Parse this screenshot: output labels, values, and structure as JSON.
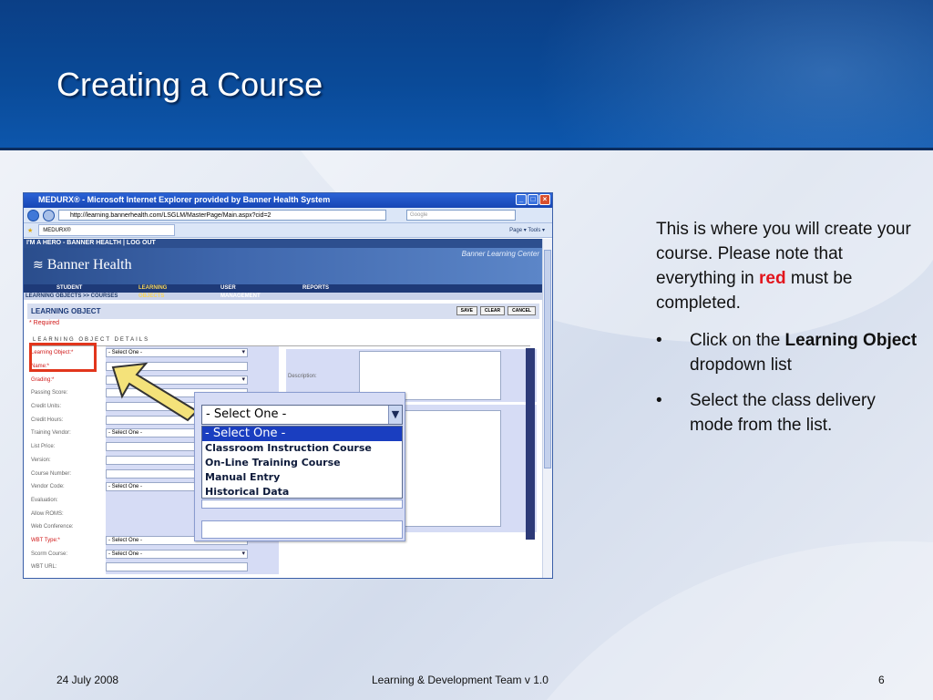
{
  "slide": {
    "title": "Creating a Course",
    "footer_date": "24 July 2008",
    "footer_center": "Learning & Development Team v 1.0",
    "page_number": "6"
  },
  "browser": {
    "window_title": "MEDURX® - Microsoft Internet Explorer provided by Banner Health System",
    "url": "http://learning.bannerhealth.com/LSGLM/MasterPage/Main.aspx?cid=2",
    "search_placeholder": "Google",
    "tab_label": "MEDURX®",
    "tools": "Page ▾  Tools ▾"
  },
  "app": {
    "hero_bar": "I'M A HERO - BANNER HEALTH | LOG OUT",
    "brand": "Banner Health",
    "center_name": "Banner Learning Center",
    "nav": [
      "STUDENT",
      "LEARNING OBJECTS",
      "USER MANAGEMENT",
      "REPORTS"
    ],
    "breadcrumb": "LEARNING OBJECTS >> COURSES",
    "section_title": "LEARNING OBJECT",
    "buttons": {
      "save": "SAVE",
      "clear": "CLEAR",
      "cancel": "CANCEL"
    },
    "required_note": "* Required",
    "details_header": "LEARNING OBJECT DETAILS",
    "description_label": "Description:"
  },
  "form_rows": [
    {
      "label": "Learning Object:*",
      "required": true,
      "value": "- Select One -",
      "select": true
    },
    {
      "label": "Name:*",
      "required": true,
      "value": "",
      "select": false
    },
    {
      "label": "Grading:*",
      "required": true,
      "value": "",
      "select": true
    },
    {
      "label": "Passing Score:",
      "required": false,
      "value": "",
      "select": false
    },
    {
      "label": "Credit Units:",
      "required": false,
      "value": "",
      "select": false
    },
    {
      "label": "Credit Hours:",
      "required": false,
      "value": "",
      "select": false
    },
    {
      "label": "Training Vendor:",
      "required": false,
      "value": "- Select One -",
      "select": true
    },
    {
      "label": "List Price:",
      "required": false,
      "value": "",
      "select": false
    },
    {
      "label": "Version:",
      "required": false,
      "value": "",
      "select": false
    },
    {
      "label": "Course Number:",
      "required": false,
      "value": "",
      "select": false
    },
    {
      "label": "Vendor Code:",
      "required": false,
      "value": "- Select One -",
      "select": true
    },
    {
      "label": "Evaluation:",
      "required": false,
      "value": "",
      "select": null
    },
    {
      "label": "Allow ROMS:",
      "required": false,
      "value": "",
      "select": null
    },
    {
      "label": "Web Conference:",
      "required": false,
      "value": "",
      "select": null
    },
    {
      "label": "WBT Type:*",
      "required": true,
      "value": "- Select One -",
      "select": true
    },
    {
      "label": "Scorm Course:",
      "required": false,
      "value": "- Select One -",
      "select": true
    },
    {
      "label": "WBT URL:",
      "required": false,
      "value": "",
      "select": false
    }
  ],
  "dropdown": {
    "selected": "- Select One -",
    "options": [
      "- Select One -",
      "Classroom Instruction Course",
      "On-Line Training Course",
      "Manual Entry",
      "Historical Data"
    ],
    "highlighted_index": 0
  },
  "notes": {
    "intro_before": "This is where you will create your course. Please note that everything in ",
    "intro_red": "red",
    "intro_after": " must be completed.",
    "bullet1_before": "Click on the ",
    "bullet1_bold": "Learning Object",
    "bullet1_after": " dropdown list",
    "bullet2": "Select the class delivery mode from the list.",
    "bullet_char": "•"
  },
  "colors": {
    "header_blue": "#0b4a98",
    "highlight_red": "#e2361c",
    "arrow_fill": "#f4e27a"
  }
}
